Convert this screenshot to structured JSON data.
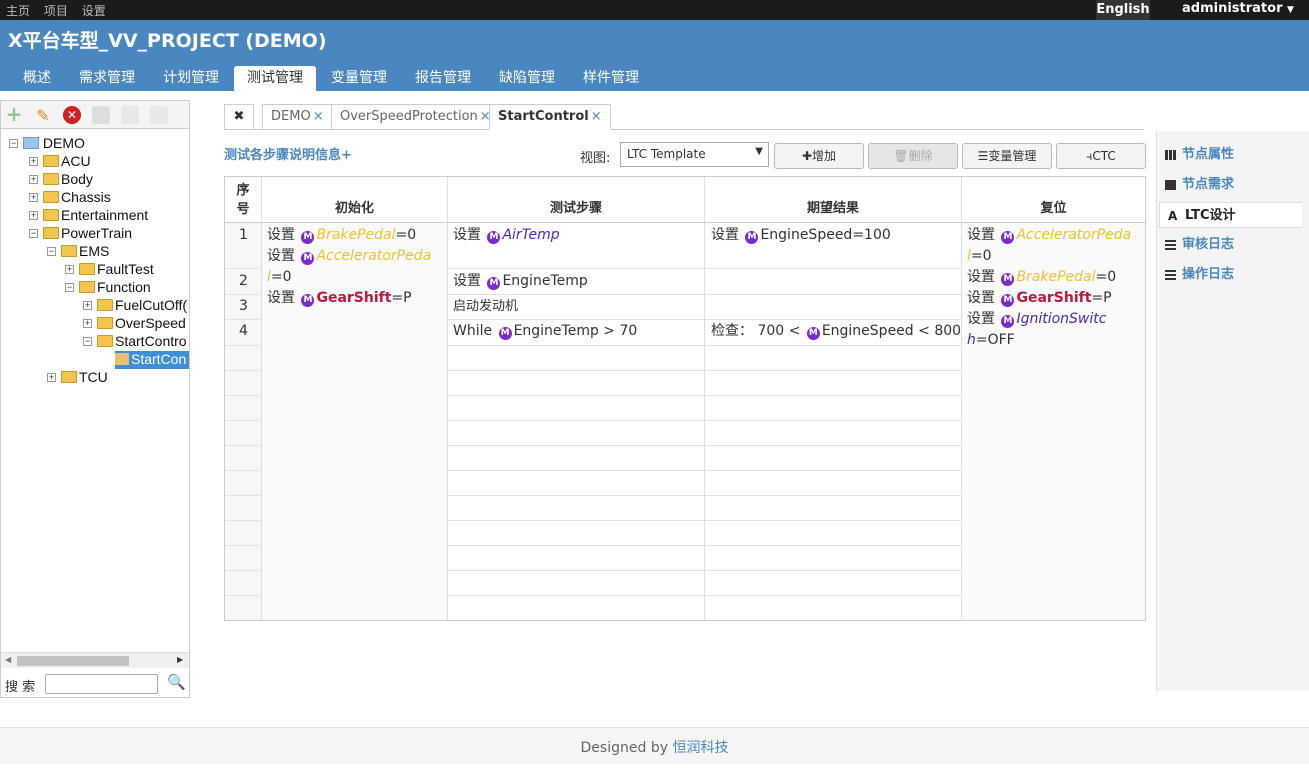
{
  "topbar": {
    "home": "主页",
    "project": "项目",
    "settings": "设置",
    "language": "English",
    "user": "administrator"
  },
  "header": {
    "title": "X平台车型_VV_PROJECT (DEMO)",
    "tabs": [
      "概述",
      "需求管理",
      "计划管理",
      "测试管理",
      "变量管理",
      "报告管理",
      "缺陷管理",
      "样件管理"
    ]
  },
  "tree": {
    "root": "DEMO",
    "acu": "ACU",
    "body": "Body",
    "chassis": "Chassis",
    "entertainment": "Entertainment",
    "powertrain": "PowerTrain",
    "ems": "EMS",
    "faulttest": "FaultTest",
    "function": "Function",
    "fuelcut": "FuelCutOff(",
    "overspeed": "OverSpeed",
    "startcontrol": "StartContro",
    "startcon": "StartCon",
    "tcu": "TCU"
  },
  "search": {
    "label": "搜 索",
    "value": ""
  },
  "doc_tabs": {
    "t1": "DEMO",
    "t2": "OverSpeedProtection",
    "t3": "StartControl",
    "close": "×"
  },
  "toolbar": {
    "desc": "测试各步骤说明信息+",
    "view_label": "视图:",
    "view_value": "LTC Template",
    "add": "增加",
    "delete": "删除",
    "var_mgmt": "变量管理",
    "ctc": "CTC"
  },
  "grid": {
    "headers": {
      "seq1": "序",
      "seq2": "号",
      "init": "初始化",
      "steps": "测试步骤",
      "expected": "期望结果",
      "reset": "复位"
    },
    "row_nums": [
      "1",
      "2",
      "3",
      "4"
    ],
    "set": "设置",
    "init": {
      "v1": "BrakePedal",
      "v1b": "=0",
      "v2a": "AcceleratorPeda",
      "v2b": "l",
      "v2c": "=0",
      "v3": "GearShift",
      "v3b": "=P"
    },
    "steps": {
      "s1": "AirTemp",
      "s2": "EngineTemp",
      "s3": "启动发动机",
      "s4a": "While",
      "s4b": "EngineTemp",
      "s4c": " > 70"
    },
    "expected": {
      "e1": "EngineSpeed=100",
      "e4a": "检查：  700 <",
      "e4b": "EngineSpeed",
      "e4c": " < 800"
    },
    "reset": {
      "r1a": "AcceleratorPeda",
      "r1b": "l",
      "r1c": "=0",
      "r2": "BrakePedal",
      "r2b": "=0",
      "r3": "GearShift",
      "r3b": "=P",
      "r4a": "IgnitionSwitc",
      "r4b": "h",
      "r4c": "=OFF"
    }
  },
  "right": {
    "items": [
      "节点属性",
      "节点需求",
      "LTC设计",
      "审核日志",
      "操作日志"
    ]
  },
  "footer": {
    "designed": "Designed by ",
    "company": "恒润科技"
  }
}
